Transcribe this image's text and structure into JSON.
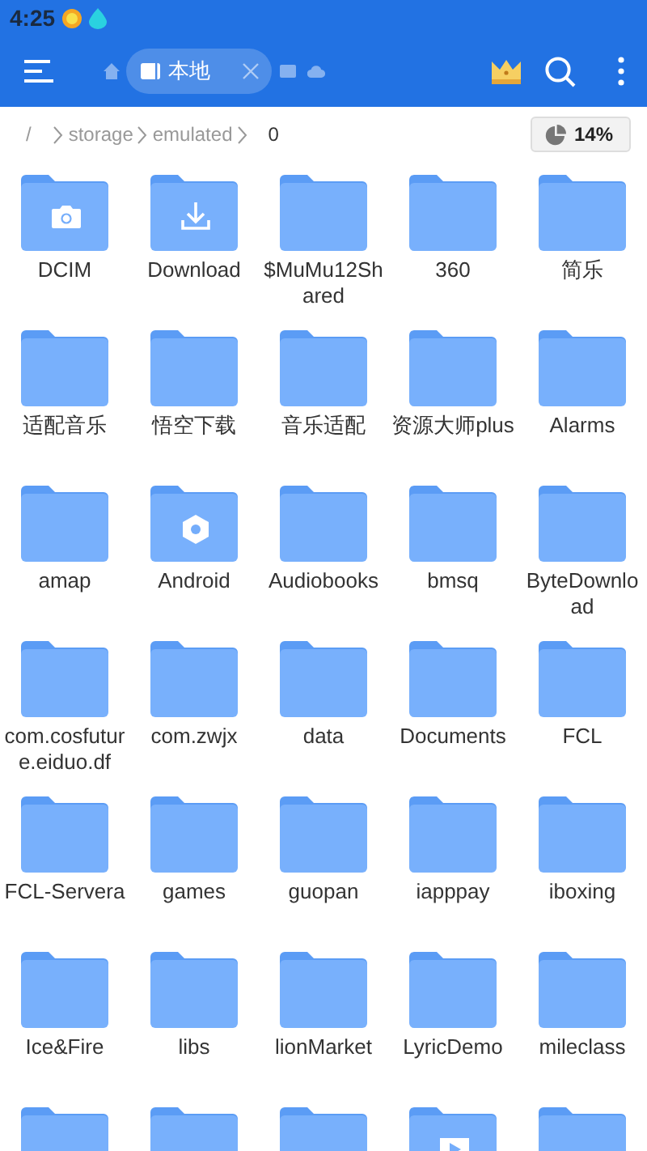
{
  "status_bar": {
    "time": "4:25"
  },
  "toolbar": {
    "tabs": [
      {
        "label": "本地",
        "selected": true
      }
    ]
  },
  "breadcrumb": [
    {
      "label": "/",
      "selected": false
    },
    {
      "label": "storage",
      "selected": false
    },
    {
      "label": "emulated",
      "selected": false
    },
    {
      "label": "0",
      "selected": true
    }
  ],
  "storage_badge": {
    "label": "14%"
  },
  "folders": [
    {
      "name": "DCIM",
      "kind": "camera"
    },
    {
      "name": "Download",
      "kind": "download"
    },
    {
      "name": "$MuMu12Shared",
      "kind": "plain"
    },
    {
      "name": "360",
      "kind": "plain"
    },
    {
      "name": "简乐",
      "kind": "plain"
    },
    {
      "name": "适配音乐",
      "kind": "plain"
    },
    {
      "name": "悟空下载",
      "kind": "plain"
    },
    {
      "name": "音乐适配",
      "kind": "plain"
    },
    {
      "name": "资源大师plus",
      "kind": "plain"
    },
    {
      "name": "Alarms",
      "kind": "plain"
    },
    {
      "name": "amap",
      "kind": "plain"
    },
    {
      "name": "Android",
      "kind": "gear"
    },
    {
      "name": "Audiobooks",
      "kind": "plain"
    },
    {
      "name": "bmsq",
      "kind": "plain"
    },
    {
      "name": "ByteDownload",
      "kind": "plain"
    },
    {
      "name": "com.cosfuture.eiduo.df",
      "kind": "plain"
    },
    {
      "name": "com.zwjx",
      "kind": "plain"
    },
    {
      "name": "data",
      "kind": "plain"
    },
    {
      "name": "Documents",
      "kind": "plain"
    },
    {
      "name": "FCL",
      "kind": "plain"
    },
    {
      "name": "FCL-Servera",
      "kind": "plain"
    },
    {
      "name": "games",
      "kind": "plain"
    },
    {
      "name": "guopan",
      "kind": "plain"
    },
    {
      "name": "iapppay",
      "kind": "plain"
    },
    {
      "name": "iboxing",
      "kind": "plain"
    },
    {
      "name": "Ice&Fire",
      "kind": "plain"
    },
    {
      "name": "libs",
      "kind": "plain"
    },
    {
      "name": "lionMarket",
      "kind": "plain"
    },
    {
      "name": "LyricDemo",
      "kind": "plain"
    },
    {
      "name": "mileclass",
      "kind": "plain"
    },
    {
      "kind": "plain"
    },
    {
      "kind": "plain"
    },
    {
      "kind": "plain"
    },
    {
      "kind": "video"
    },
    {
      "kind": "plain"
    }
  ]
}
